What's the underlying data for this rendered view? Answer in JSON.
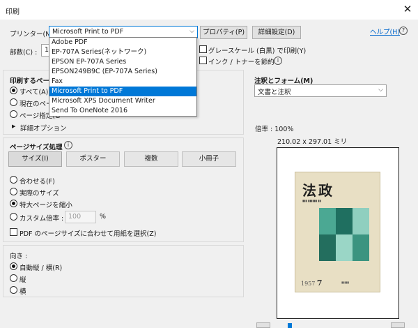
{
  "window": {
    "title": "印刷"
  },
  "printer": {
    "label": "プリンター(N) :",
    "selected": "Microsoft Print to PDF",
    "options": [
      "Adobe PDF",
      "EP-707A Series(ネットワーク)",
      "EPSON EP-707A Series",
      "EPSON249B9C (EP-707A Series)",
      "Fax",
      "Microsoft Print to PDF",
      "Microsoft XPS Document Writer",
      "Send To OneNote 2016"
    ],
    "highlighted_index": 5
  },
  "buttons": {
    "properties": "プロパティ(P)",
    "advanced": "詳細設定(D)",
    "help": "ヘルプ(H)",
    "help_icon": "?"
  },
  "copies": {
    "label": "部数(C) :",
    "value": "1"
  },
  "checkboxes": {
    "grayscale": "グレースケール (白黒) で印刷(Y)",
    "save_ink": "インク / トナーを節約",
    "info_icon": "i"
  },
  "pages_to_print": {
    "title": "印刷するページ",
    "all": "すべて(A)",
    "current": "現在のページ",
    "specify": "ページ指定(G",
    "more_options": "詳細オプション",
    "more_options_arrow": "▶"
  },
  "annotations": {
    "title": "注釈とフォーム(M)",
    "selected": "文書と注釈"
  },
  "page_sizing": {
    "title": "ページサイズ処理",
    "info_icon": "i",
    "tabs": [
      "サイズ(I)",
      "ポスター",
      "複数",
      "小冊子"
    ],
    "options": [
      "合わせる(F)",
      "実際のサイズ",
      "特大ページを縮小",
      "カスタム倍率 :"
    ],
    "selected_index": 2,
    "custom_scale_value": "100",
    "percent": "%",
    "choose_paper": "PDF のページサイズに合わせて用紙を選択(Z)"
  },
  "orientation": {
    "title": "向き :",
    "options": [
      "自動縦 / 横(R)",
      "縦",
      "横"
    ],
    "selected_index": 0
  },
  "preview": {
    "zoom": "倍率 : 100%",
    "dimensions": "210.02 x 297.01 ミリ",
    "cover_title": "法政",
    "cover_issue": "1957",
    "cover_issue_month": "7"
  },
  "colors": {
    "selection_blue": "#0078d7",
    "link_blue": "#0066cc",
    "cover_paper": "#e8dfc4",
    "cover_art_green": "#2c8a77"
  },
  "icons": {
    "close": "close-icon",
    "dropdown": "chevron-down-icon",
    "expand": "triangle-right-icon",
    "help": "help-circle-icon",
    "info": "info-circle-icon"
  }
}
